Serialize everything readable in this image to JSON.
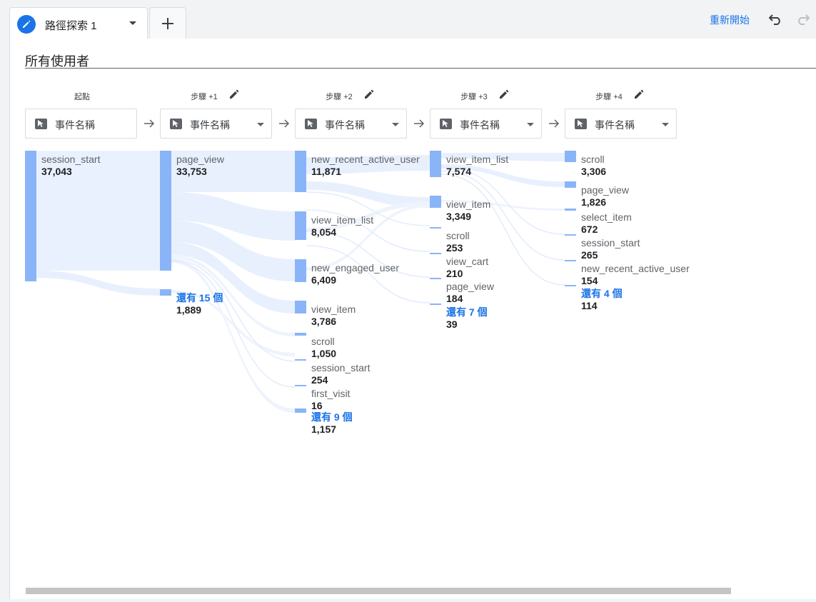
{
  "tabs": {
    "active_title": "路徑探索 1",
    "add_label": "+"
  },
  "toolbar": {
    "restart_label": "重新開始",
    "undo_icon": "undo-icon",
    "redo_icon": "redo-icon"
  },
  "segment": {
    "title": "所有使用者"
  },
  "colors": {
    "node": "#8ab4f8",
    "link": "#e8f0fe",
    "accent": "#1a73e8"
  },
  "steps": [
    {
      "label": "起點",
      "dimension": "事件名稱",
      "editable": false,
      "nodes": [
        {
          "name": "session_start",
          "value": "37,043"
        }
      ]
    },
    {
      "label": "步驟 +1",
      "dimension": "事件名稱",
      "editable": true,
      "nodes": [
        {
          "name": "page_view",
          "value": "33,753"
        },
        {
          "name": "還有 15 個",
          "value": "1,889",
          "more": true
        }
      ]
    },
    {
      "label": "步驟 +2",
      "dimension": "事件名稱",
      "editable": true,
      "nodes": [
        {
          "name": "new_recent_active_user",
          "value": "11,871"
        },
        {
          "name": "view_item_list",
          "value": "8,054"
        },
        {
          "name": "new_engaged_user",
          "value": "6,409"
        },
        {
          "name": "view_item",
          "value": "3,786"
        },
        {
          "name": "scroll",
          "value": "1,050"
        },
        {
          "name": "session_start",
          "value": "254"
        },
        {
          "name": "first_visit",
          "value": "16"
        },
        {
          "name": "還有 9 個",
          "value": "1,157",
          "more": true
        }
      ]
    },
    {
      "label": "步驟 +3",
      "dimension": "事件名稱",
      "editable": true,
      "nodes": [
        {
          "name": "view_item_list",
          "value": "7,574"
        },
        {
          "name": "view_item",
          "value": "3,349"
        },
        {
          "name": "scroll",
          "value": "253"
        },
        {
          "name": "view_cart",
          "value": "210"
        },
        {
          "name": "page_view",
          "value": "184"
        },
        {
          "name": "還有 7 個",
          "value": "39",
          "more": true
        }
      ]
    },
    {
      "label": "步驟 +4",
      "dimension": "事件名稱",
      "editable": true,
      "nodes": [
        {
          "name": "scroll",
          "value": "3,306"
        },
        {
          "name": "page_view",
          "value": "1,826"
        },
        {
          "name": "select_item",
          "value": "672"
        },
        {
          "name": "session_start",
          "value": "265"
        },
        {
          "name": "new_recent_active_user",
          "value": "154"
        },
        {
          "name": "還有 4 個",
          "value": "114",
          "more": true
        }
      ]
    }
  ]
}
